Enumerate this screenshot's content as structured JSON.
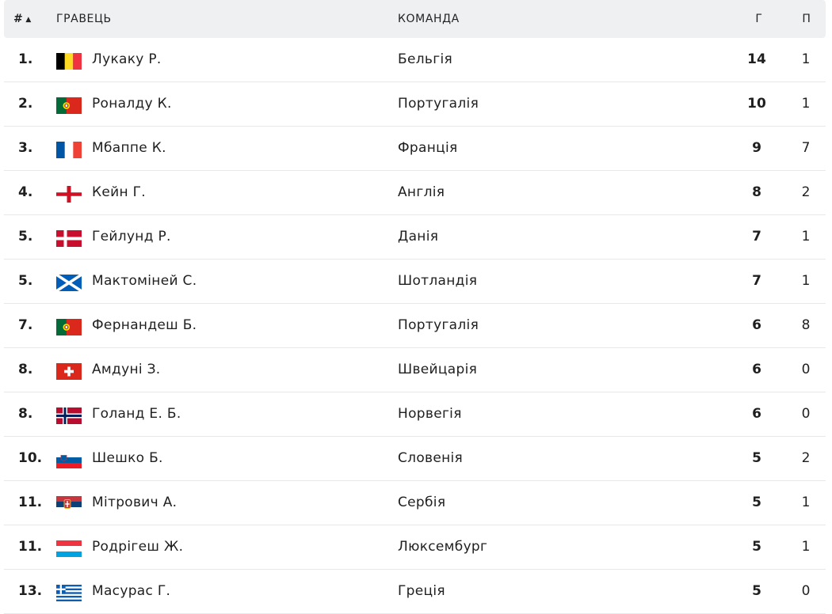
{
  "header": {
    "rank": "#",
    "sort_arrow": "▲",
    "player": "ГРАВЕЦЬ",
    "team": "КОМАНДА",
    "goals": "Г",
    "assists": "П"
  },
  "rows": [
    {
      "rank": "1.",
      "flag": "belgium",
      "player": "Лукаку Р.",
      "team": "Бельгія",
      "goals": "14",
      "assists": "1"
    },
    {
      "rank": "2.",
      "flag": "portugal",
      "player": "Роналду К.",
      "team": "Португалія",
      "goals": "10",
      "assists": "1"
    },
    {
      "rank": "3.",
      "flag": "france",
      "player": "Мбаппе К.",
      "team": "Франція",
      "goals": "9",
      "assists": "7"
    },
    {
      "rank": "4.",
      "flag": "england",
      "player": "Кейн Г.",
      "team": "Англія",
      "goals": "8",
      "assists": "2"
    },
    {
      "rank": "5.",
      "flag": "denmark",
      "player": "Гейлунд Р.",
      "team": "Данія",
      "goals": "7",
      "assists": "1"
    },
    {
      "rank": "5.",
      "flag": "scotland",
      "player": "Мактоміней С.",
      "team": "Шотландія",
      "goals": "7",
      "assists": "1"
    },
    {
      "rank": "7.",
      "flag": "portugal",
      "player": "Фернандеш Б.",
      "team": "Португалія",
      "goals": "6",
      "assists": "8"
    },
    {
      "rank": "8.",
      "flag": "switzerland",
      "player": "Амдуні З.",
      "team": "Швейцарія",
      "goals": "6",
      "assists": "0"
    },
    {
      "rank": "8.",
      "flag": "norway",
      "player": "Голанд Е. Б.",
      "team": "Норвегія",
      "goals": "6",
      "assists": "0"
    },
    {
      "rank": "10.",
      "flag": "slovenia",
      "player": "Шешко Б.",
      "team": "Словенія",
      "goals": "5",
      "assists": "2"
    },
    {
      "rank": "11.",
      "flag": "serbia",
      "player": "Мітрович А.",
      "team": "Сербія",
      "goals": "5",
      "assists": "1"
    },
    {
      "rank": "11.",
      "flag": "luxembourg",
      "player": "Родрігеш Ж.",
      "team": "Люксембург",
      "goals": "5",
      "assists": "1"
    },
    {
      "rank": "13.",
      "flag": "greece",
      "player": "Масурас Г.",
      "team": "Греція",
      "goals": "5",
      "assists": "0"
    }
  ]
}
